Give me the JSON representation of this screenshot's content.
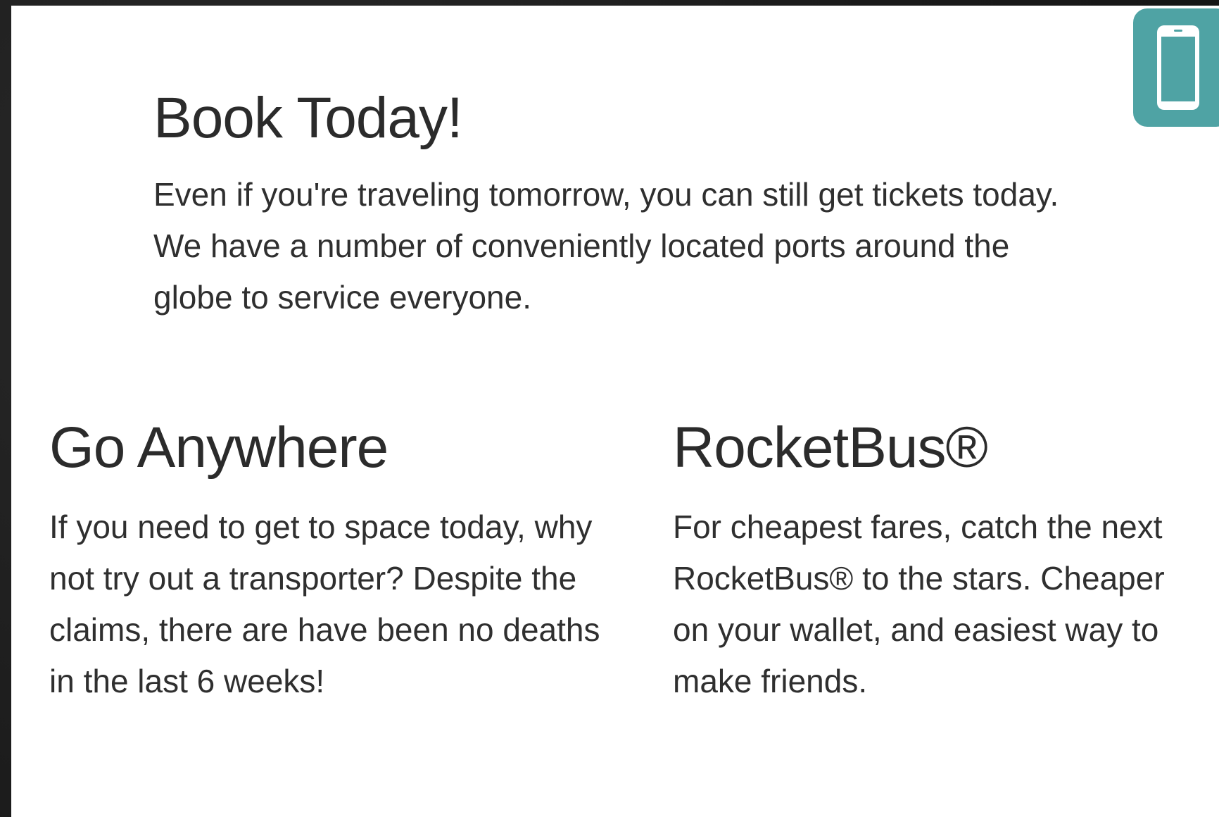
{
  "hero": {
    "title": "Book Today!",
    "text": "Even if you're traveling tomorrow, you can still get tickets today. We have a number of conveniently located ports around the globe to service everyone."
  },
  "features": [
    {
      "title": "Go Anywhere",
      "text": "If you need to get to space today, why not try out a transporter? Despite the claims, there are have been no deaths in the last 6 weeks!"
    },
    {
      "title": "RocketBus®",
      "text": "For cheapest fares, catch the next RocketBus® to the stars. Cheaper on your wallet, and easiest way to make friends."
    }
  ],
  "device_badge": {
    "icon": "smartphone-icon",
    "color": "#4fa3a4"
  }
}
